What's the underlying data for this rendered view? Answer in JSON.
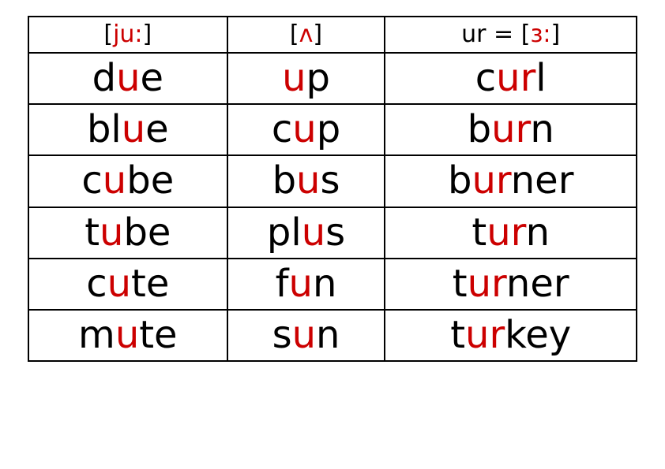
{
  "headers": [
    {
      "parts": [
        {
          "t": "[",
          "hl": false
        },
        {
          "t": "ju:",
          "hl": true
        },
        {
          "t": "]",
          "hl": false
        }
      ]
    },
    {
      "parts": [
        {
          "t": "[",
          "hl": false
        },
        {
          "t": "ʌ",
          "hl": true
        },
        {
          "t": "]",
          "hl": false
        }
      ]
    },
    {
      "parts": [
        {
          "t": "ur = [",
          "hl": false
        },
        {
          "t": "ɜ:",
          "hl": true
        },
        {
          "t": "]",
          "hl": false
        }
      ]
    }
  ],
  "rows": [
    [
      {
        "parts": [
          {
            "t": "d",
            "hl": false
          },
          {
            "t": "u",
            "hl": true
          },
          {
            "t": "e",
            "hl": false
          }
        ]
      },
      {
        "parts": [
          {
            "t": "u",
            "hl": true
          },
          {
            "t": "p",
            "hl": false
          }
        ]
      },
      {
        "parts": [
          {
            "t": "c",
            "hl": false
          },
          {
            "t": "ur",
            "hl": true
          },
          {
            "t": "l",
            "hl": false
          }
        ]
      }
    ],
    [
      {
        "parts": [
          {
            "t": "bl",
            "hl": false
          },
          {
            "t": "u",
            "hl": true
          },
          {
            "t": "e",
            "hl": false
          }
        ]
      },
      {
        "parts": [
          {
            "t": "c",
            "hl": false
          },
          {
            "t": "u",
            "hl": true
          },
          {
            "t": "p",
            "hl": false
          }
        ]
      },
      {
        "parts": [
          {
            "t": "b",
            "hl": false
          },
          {
            "t": "ur",
            "hl": true
          },
          {
            "t": "n",
            "hl": false
          }
        ]
      }
    ],
    [
      {
        "parts": [
          {
            "t": "c",
            "hl": false
          },
          {
            "t": "u",
            "hl": true
          },
          {
            "t": "be",
            "hl": false
          }
        ]
      },
      {
        "parts": [
          {
            "t": "b",
            "hl": false
          },
          {
            "t": "u",
            "hl": true
          },
          {
            "t": "s",
            "hl": false
          }
        ]
      },
      {
        "parts": [
          {
            "t": "b",
            "hl": false
          },
          {
            "t": "ur",
            "hl": true
          },
          {
            "t": "ner",
            "hl": false
          }
        ]
      }
    ],
    [
      {
        "parts": [
          {
            "t": "t",
            "hl": false
          },
          {
            "t": "u",
            "hl": true
          },
          {
            "t": "be",
            "hl": false
          }
        ]
      },
      {
        "parts": [
          {
            "t": "pl",
            "hl": false
          },
          {
            "t": "u",
            "hl": true
          },
          {
            "t": "s",
            "hl": false
          }
        ]
      },
      {
        "parts": [
          {
            "t": "t",
            "hl": false
          },
          {
            "t": "ur",
            "hl": true
          },
          {
            "t": "n",
            "hl": false
          }
        ]
      }
    ],
    [
      {
        "parts": [
          {
            "t": "c",
            "hl": false
          },
          {
            "t": "u",
            "hl": true
          },
          {
            "t": "te",
            "hl": false
          }
        ]
      },
      {
        "parts": [
          {
            "t": "f",
            "hl": false
          },
          {
            "t": "u",
            "hl": true
          },
          {
            "t": "n",
            "hl": false
          }
        ]
      },
      {
        "parts": [
          {
            "t": "t",
            "hl": false
          },
          {
            "t": "ur",
            "hl": true
          },
          {
            "t": "ner",
            "hl": false
          }
        ]
      }
    ],
    [
      {
        "parts": [
          {
            "t": "m",
            "hl": false
          },
          {
            "t": "u",
            "hl": true
          },
          {
            "t": "te",
            "hl": false
          }
        ]
      },
      {
        "parts": [
          {
            "t": "s",
            "hl": false
          },
          {
            "t": "u",
            "hl": true
          },
          {
            "t": "n",
            "hl": false
          }
        ]
      },
      {
        "parts": [
          {
            "t": "t",
            "hl": false
          },
          {
            "t": "ur",
            "hl": true
          },
          {
            "t": "key",
            "hl": false
          }
        ]
      }
    ]
  ]
}
